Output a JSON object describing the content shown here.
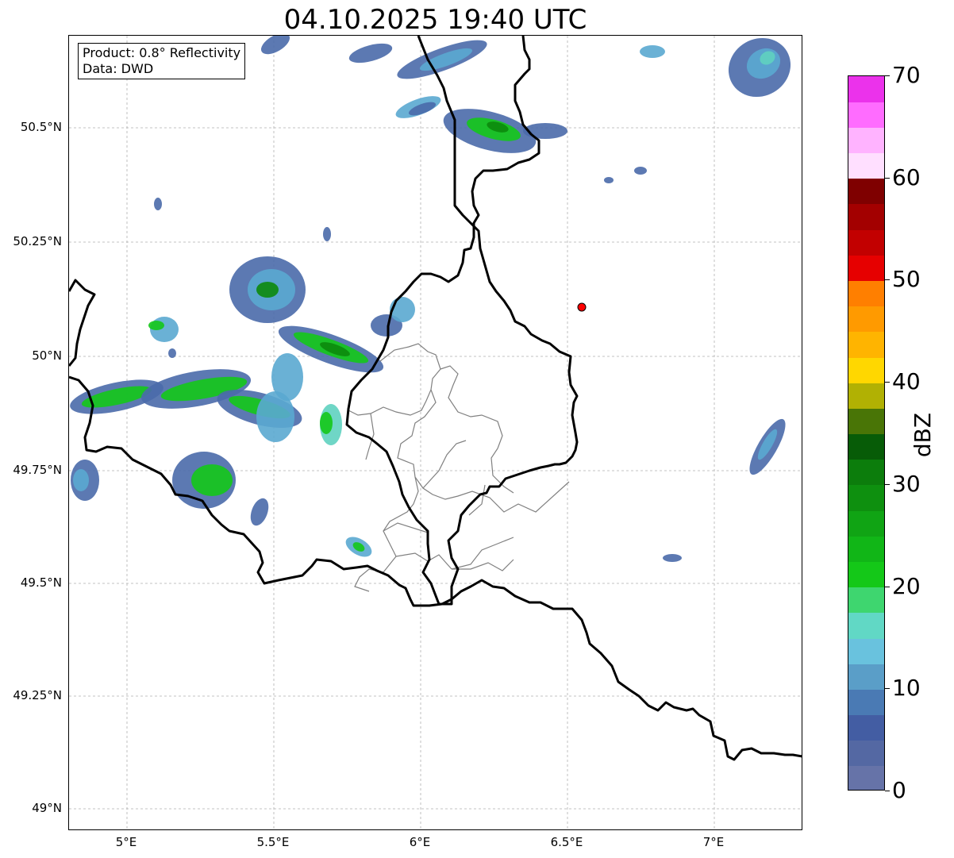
{
  "title": "04.10.2025 19:40 UTC",
  "info_box": {
    "line1": "Product: 0.8° Reflectivity",
    "line2": "Data: DWD"
  },
  "latitude_labels": [
    "50.5°N",
    "50.25°N",
    "50°N",
    "49.75°N",
    "49.5°N",
    "49.25°N",
    "49°N"
  ],
  "longitude_labels": [
    "5°E",
    "5.5°E",
    "6°E",
    "6.5°E",
    "7°E"
  ],
  "colorbar": {
    "label": "dBZ",
    "ticks": [
      "0",
      "10",
      "20",
      "30",
      "40",
      "50",
      "60",
      "70"
    ],
    "range": [
      0,
      70
    ],
    "step": 2.5,
    "colors": [
      "#6673a8",
      "#5468a3",
      "#435da3",
      "#4a7ab4",
      "#5a9ec8",
      "#69c2de",
      "#61d8c5",
      "#3ed66f",
      "#14c818",
      "#11b617",
      "#10a414",
      "#0e900f",
      "#0c7d0c",
      "#075c07",
      "#497506",
      "#b1b103",
      "#ffd700",
      "#ffb400",
      "#ff9a00",
      "#ff7f00",
      "#e60000",
      "#c20000",
      "#a30000",
      "#7f0000",
      "#ffdfff",
      "#ffb3ff",
      "#ff6cff",
      "#eb32eb"
    ]
  },
  "marker": {
    "color": "#ff0000",
    "lon": 6.55,
    "lat": 50.11
  },
  "map_extent": {
    "lon": [
      4.8,
      7.3
    ],
    "lat": [
      48.95,
      50.7
    ]
  },
  "colors": {
    "border": "#000000",
    "districts": "#808080",
    "grid": "#b0b0b0"
  }
}
